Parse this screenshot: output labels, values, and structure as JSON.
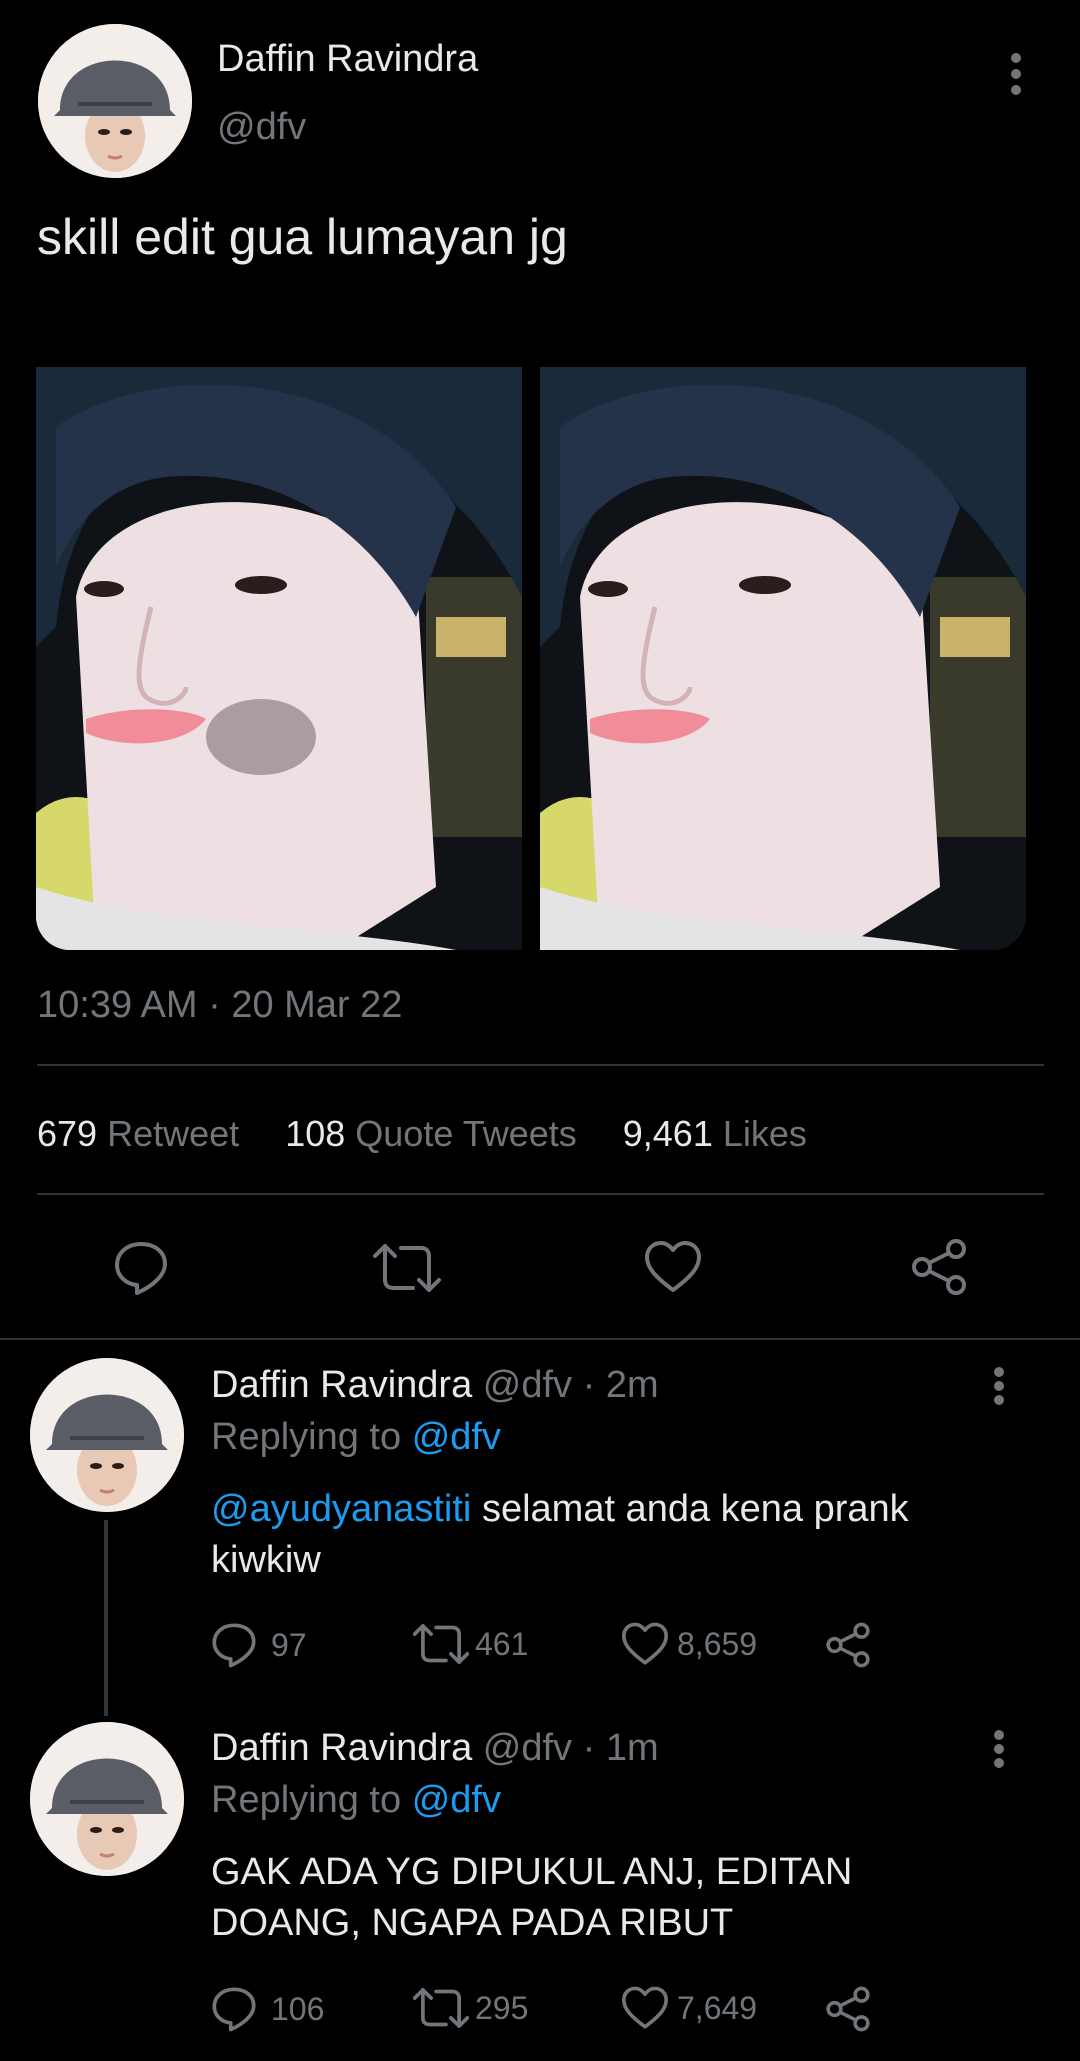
{
  "main_tweet": {
    "author_name": "Daffin Ravindra",
    "handle": "@dfv",
    "text": "skill edit gua lumayan jg",
    "timestamp": "10:39 AM · 20 Mar 22",
    "stats": {
      "retweets_count": "679",
      "retweets_label": "Retweet",
      "quotes_count": "108",
      "quotes_label": "Quote Tweets",
      "likes_count": "9,461",
      "likes_label": "Likes"
    }
  },
  "replies": [
    {
      "author_name": "Daffin Ravindra",
      "meta": "@dfv · 2m",
      "replying_prefix": "Replying to",
      "replying_handle": "@dfv",
      "mention": "@ayudyanastiti",
      "text_line1": " selamat anda kena prank",
      "text_line2": "kiwkiw",
      "reply_count": "97",
      "retweet_count": "461",
      "like_count": "8,659"
    },
    {
      "author_name": "Daffin Ravindra",
      "meta": "@dfv · 1m",
      "replying_prefix": "Replying to",
      "replying_handle": "@dfv",
      "text_line1": "GAK ADA YG DIPUKUL ANJ, EDITAN",
      "text_line2": "DOANG, NGAPA PADA RIBUT",
      "reply_count": "106",
      "retweet_count": "295",
      "like_count": "7,649"
    }
  ],
  "icons": {
    "reply": "speech-bubble-icon",
    "retweet": "retweet-arrows-icon",
    "like": "heart-icon",
    "share": "share-nodes-icon",
    "more": "vertical-dots-icon"
  },
  "colors": {
    "background": "#000000",
    "text": "#e7e9ea",
    "muted": "#71767b",
    "link": "#1d9bf0",
    "divider": "#2f3336"
  }
}
